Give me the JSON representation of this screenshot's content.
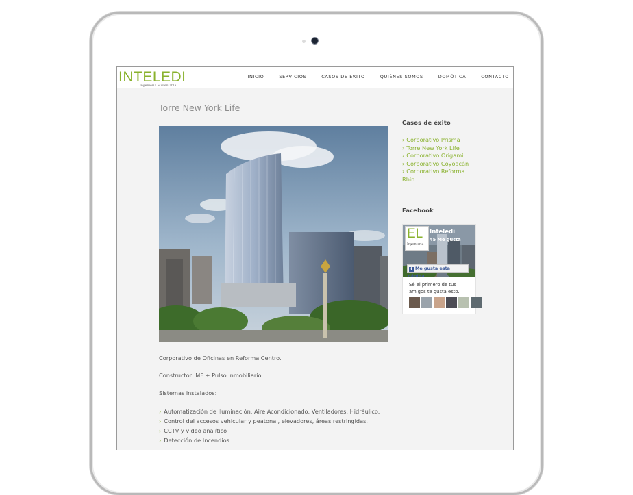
{
  "brand": {
    "logo_main": "INTELEDI",
    "logo_tagline": "Ingeniería Sustentable"
  },
  "nav": [
    "INICIO",
    "SERVICIOS",
    "CASOS DE ÉXITO",
    "QUIÉNES SOMOS",
    "DOMÓTICA",
    "CONTACTO"
  ],
  "page": {
    "title": "Torre New York Life",
    "description": "Corporativo de Oficinas en Reforma Centro.",
    "constructor": "Constructor: MF + Pulso Inmobiliario",
    "systems_label": "Sistemas instalados:",
    "systems": [
      "Automatización de Iluminación, Aire Acondicionado, Ventiladores, Hidráulico.",
      "Control del accesos vehicular y peatonal, elevadores, áreas restringidas.",
      "CCTV y video analítico",
      "Detección de Incendios."
    ]
  },
  "sidebar": {
    "cases_heading": "Casos de éxito",
    "cases": [
      "Corporativo Prisma",
      "Torre New York Life",
      "Corporativo Origami",
      "Corporativo Coyoacán",
      "Corporativo Reforma Rhin"
    ],
    "facebook_heading": "Facebook",
    "facebook": {
      "thumb_text": "EL",
      "thumb_sub": "Ingeniería",
      "page_name": "Inteledi",
      "likes": "45 Me gusta",
      "like_button": "Me gusta esta página",
      "friends_text": "Sé el primero de tus amigos te gusta esto."
    }
  },
  "colors": {
    "accent": "#8ab22e",
    "text": "#555555",
    "background": "#f3f3f3"
  }
}
